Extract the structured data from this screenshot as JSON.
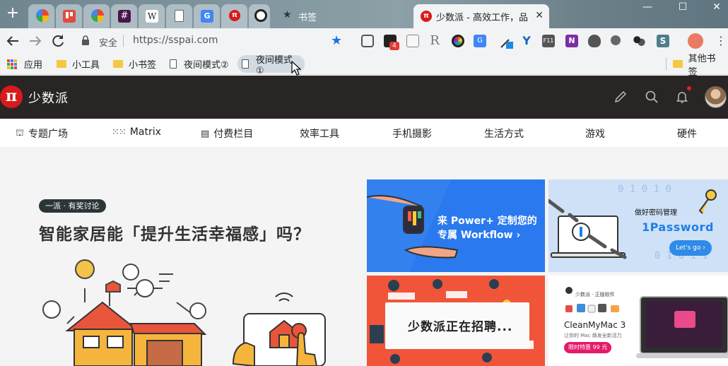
{
  "browser": {
    "new_tab_symbol": "+",
    "tabs": [
      {
        "name": "Google",
        "icon": "google-icon",
        "color": "#4285f4"
      },
      {
        "name": "Trello",
        "icon": "trello-icon",
        "color": "#e24a3b"
      },
      {
        "name": "Google",
        "icon": "google-icon",
        "color": "#4285f4"
      },
      {
        "name": "Slack",
        "icon": "slack-icon",
        "color": "#4a154b"
      },
      {
        "name": "Wikipedia",
        "icon": "wikipedia-icon",
        "color": "#ffffff"
      },
      {
        "name": "Document",
        "icon": "document-icon",
        "color": "#ffffff"
      },
      {
        "name": "Google Translate",
        "icon": "translate-icon",
        "color": "#4285f4"
      },
      {
        "name": "sspai",
        "icon": "sspai-icon",
        "color": "#d71a1b"
      },
      {
        "name": "Panda",
        "icon": "panda-icon",
        "color": "#ffffff"
      }
    ],
    "bookmark_tab_title": "书签",
    "active_tab_title": "少数派 - 高效工作，品质生活",
    "window_controls": {
      "minimize": "—",
      "maximize": "☐",
      "close": "✕"
    }
  },
  "toolbar": {
    "security_label": "安全",
    "url": "https://sspai.com",
    "extension_badge": "4",
    "extensions": [
      "pocket-icon",
      "todoist-icon",
      "reader-icon",
      "readability-icon",
      "colorpicker-icon",
      "translate-icon",
      "eyedropper-icon",
      "vue-devtools-icon",
      "f11-icon",
      "onenote-icon",
      "evernote-icon",
      "lightbulb-icon",
      "extension-icon",
      "s-icon",
      "profile-avatar"
    ]
  },
  "bookmarks": {
    "apps_label": "应用",
    "items": [
      {
        "label": "小工具",
        "type": "folder"
      },
      {
        "label": "小书签",
        "type": "folder"
      },
      {
        "label": "夜间模式②",
        "type": "page"
      },
      {
        "label": "夜间模式①",
        "type": "page",
        "hovered": true
      }
    ],
    "other_label": "其他书签"
  },
  "site": {
    "logo_char": "π",
    "name": "少数派",
    "nav": [
      {
        "label": "专题广场",
        "icon": "plaza-icon"
      },
      {
        "label": "Matrix",
        "icon": "dots-grid-icon"
      },
      {
        "label": "付费栏目",
        "icon": "column-icon"
      },
      {
        "label": "效率工具"
      },
      {
        "label": "手机摄影"
      },
      {
        "label": "生活方式"
      },
      {
        "label": "游戏"
      },
      {
        "label": "硬件"
      }
    ]
  },
  "hero": {
    "badge": "一派 · 有奖讨论",
    "title": "智能家居能「提升生活幸福感」吗？"
  },
  "cards": {
    "power_line1": "来 Power+ 定制您的",
    "power_line2": "专属 Workflow ›",
    "onepassword_lead": "做好密码管理",
    "onepassword_name": "1Password",
    "onepassword_cta": "Let's go ›",
    "hiring_text": "少数派正在招聘...",
    "cmm_lead": "少数派 · 正版软件",
    "cmm_name": "CleanMyMac 3",
    "cmm_sub": "让你的 Mac 焕发全新活力",
    "cmm_price": "限时特惠 99 元"
  }
}
